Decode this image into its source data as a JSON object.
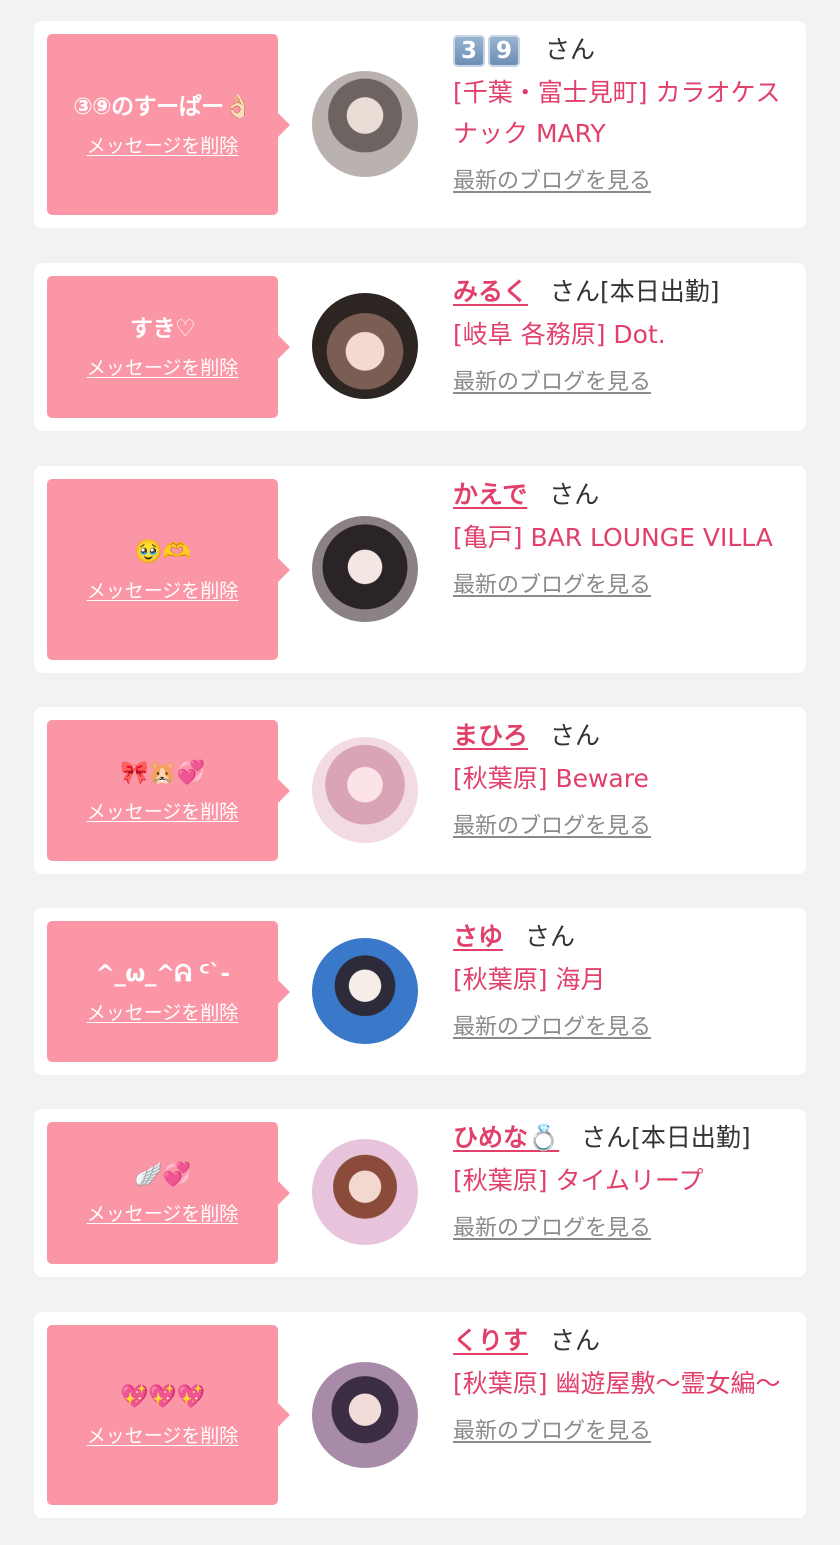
{
  "common": {
    "delete_label": "メッセージを削除",
    "blog_label": "最新のブログを見る",
    "san_label": "さん",
    "accent": "#e0406a",
    "bubble_color": "#fb96a6"
  },
  "items": [
    {
      "message": "③⑨のすーぱー👌🏻",
      "name": "39",
      "name_display": "3️⃣9️⃣",
      "badge": "",
      "shop": "[千葉・富士見町] カラオケスナック MARY",
      "avatar_icon": "avatar-photo"
    },
    {
      "message": "すき♡",
      "name": "みるく",
      "badge": "[本日出勤]",
      "shop": "[岐阜 各務原] Dot.",
      "avatar_icon": "avatar-photo"
    },
    {
      "message": "🥹🫶",
      "name": "かえで",
      "badge": "",
      "shop": "[亀戸] BAR LOUNGE VILLA",
      "avatar_icon": "avatar-photo"
    },
    {
      "message": "🎀🐹💞",
      "name": "まひろ",
      "badge": "",
      "shop": "[秋葉原] Beware",
      "avatar_icon": "avatar-photo"
    },
    {
      "message": "^_ω_^ᕱ ᑦ`-",
      "name": "さゆ",
      "badge": "",
      "shop": "[秋葉原] 海月",
      "avatar_icon": "avatar-photo"
    },
    {
      "message": "🪽💞",
      "name": "ひめな💍",
      "badge": "[本日出勤]",
      "shop": "[秋葉原] タイムリープ",
      "avatar_icon": "avatar-photo"
    },
    {
      "message": "💖💖💖",
      "name": "くりす",
      "badge": "",
      "shop": "[秋葉原] 幽遊屋敷〜霊女編〜",
      "avatar_icon": "avatar-photo"
    }
  ]
}
